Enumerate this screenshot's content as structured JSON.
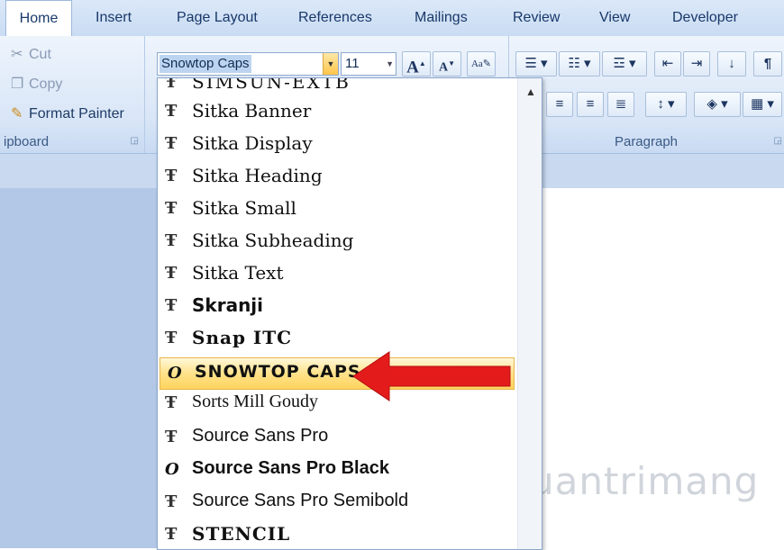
{
  "tabs": [
    "Home",
    "Insert",
    "Page Layout",
    "References",
    "Mailings",
    "Review",
    "View",
    "Developer"
  ],
  "clipboard": {
    "cut": "Cut",
    "copy": "Copy",
    "format_painter": "Format Painter",
    "group_label": "ipboard"
  },
  "font": {
    "current": "Snowtop Caps",
    "size": "11",
    "grow_label": "A",
    "shrink_label": "A"
  },
  "paragraph": {
    "group_label": "Paragraph"
  },
  "font_list": {
    "partial_top": "SIMSUN-EXTB",
    "items": [
      {
        "glyph": "Ŧ",
        "name": "Sitka Banner",
        "type": "tt"
      },
      {
        "glyph": "Ŧ",
        "name": "Sitka Display",
        "type": "tt"
      },
      {
        "glyph": "Ŧ",
        "name": "Sitka Heading",
        "type": "tt"
      },
      {
        "glyph": "Ŧ",
        "name": "Sitka Small",
        "type": "tt"
      },
      {
        "glyph": "Ŧ",
        "name": "Sitka Subheading",
        "type": "tt"
      },
      {
        "glyph": "Ŧ",
        "name": "Sitka Text",
        "type": "tt"
      },
      {
        "glyph": "Ŧ",
        "name": "Skranji",
        "type": "tt"
      },
      {
        "glyph": "Ŧ",
        "name": "Snap ITC",
        "type": "tt"
      },
      {
        "glyph": "O",
        "name": "SNOWTOP CAPS",
        "type": "ot",
        "selected": true
      },
      {
        "glyph": "Ŧ",
        "name": "Sorts Mill Goudy",
        "type": "tt"
      },
      {
        "glyph": "Ŧ",
        "name": "Source Sans Pro",
        "type": "tt"
      },
      {
        "glyph": "O",
        "name": "Source Sans Pro Black",
        "type": "ot"
      },
      {
        "glyph": "Ŧ",
        "name": "Source Sans Pro Semibold",
        "type": "tt"
      },
      {
        "glyph": "Ŧ",
        "name": "STENCIL",
        "type": "tt"
      }
    ]
  },
  "watermark": "uantrimang",
  "colors": {
    "accent": "#ffd45e",
    "arrow": "#e41b1b",
    "ribbon": "#d9e6f7"
  }
}
